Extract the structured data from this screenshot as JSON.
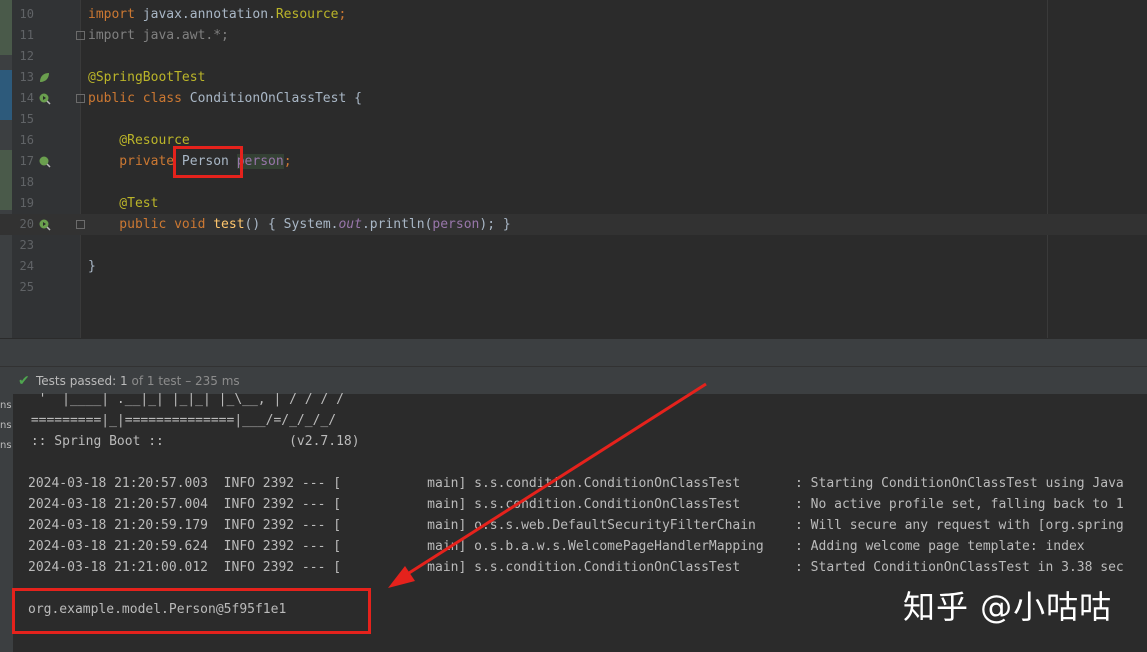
{
  "editor": {
    "lines": [
      {
        "num": "10",
        "segments": [
          {
            "t": "import ",
            "c": "kw"
          },
          {
            "t": "javax.annotation.",
            "c": "cls"
          },
          {
            "t": "Resource",
            "c": "ann"
          },
          {
            "t": ";",
            "c": "kw"
          }
        ]
      },
      {
        "num": "11",
        "segments": [
          {
            "t": "import java.awt.*;",
            "c": "res"
          }
        ]
      },
      {
        "num": "12",
        "segments": []
      },
      {
        "num": "13",
        "segments": [
          {
            "t": "@SpringBootTest",
            "c": "ann"
          }
        ]
      },
      {
        "num": "14",
        "segments": [
          {
            "t": "public class ",
            "c": "kw"
          },
          {
            "t": "ConditionOnClassTest {",
            "c": "cls"
          }
        ]
      },
      {
        "num": "15",
        "segments": []
      },
      {
        "num": "16",
        "segments": [
          {
            "t": "    @Resource",
            "c": "ann"
          }
        ]
      },
      {
        "num": "17",
        "segments": [
          {
            "t": "    private ",
            "c": "kw"
          },
          {
            "t": "Person ",
            "c": "cls"
          },
          {
            "t": "person",
            "c": "fld hl-field"
          },
          {
            "t": ";",
            "c": "kw"
          }
        ]
      },
      {
        "num": "18",
        "segments": []
      },
      {
        "num": "19",
        "segments": [
          {
            "t": "    @Test",
            "c": "ann"
          }
        ]
      },
      {
        "num": "20",
        "segments": [
          {
            "t": "    public void ",
            "c": "kw"
          },
          {
            "t": "test",
            "c": "fn"
          },
          {
            "t": "() { System.",
            "c": "cls"
          },
          {
            "t": "out",
            "c": "it"
          },
          {
            "t": ".println(",
            "c": "cls"
          },
          {
            "t": "person",
            "c": "fld"
          },
          {
            "t": "); }",
            "c": "cls"
          }
        ]
      },
      {
        "num": "23",
        "segments": []
      },
      {
        "num": "24",
        "segments": [
          {
            "t": "}",
            "c": "cls"
          }
        ]
      },
      {
        "num": "25",
        "segments": []
      }
    ]
  },
  "status": {
    "label": "Tests passed:",
    "passed": "1",
    "detail": "of 1 test – 235 ms"
  },
  "console": {
    "side_tabs": [
      "ns",
      "ns",
      "ns"
    ],
    "banner": [
      "  '  |____| .__|_| |_|_| |_\\__, | / / / /",
      " =========|_|==============|___/=/_/_/_/",
      " :: Spring Boot ::                (v2.7.18)"
    ],
    "logs": [
      "2024-03-18 21:20:57.003  INFO 2392 --- [           main] s.s.condition.ConditionOnClassTest       : Starting ConditionOnClassTest using Java",
      "2024-03-18 21:20:57.004  INFO 2392 --- [           main] s.s.condition.ConditionOnClassTest       : No active profile set, falling back to 1",
      "2024-03-18 21:20:59.179  INFO 2392 --- [           main] o.s.s.web.DefaultSecurityFilterChain     : Will secure any request with [org.spring",
      "2024-03-18 21:20:59.624  INFO 2392 --- [           main] o.s.b.a.w.s.WelcomePageHandlerMapping    : Adding welcome page template: index",
      "2024-03-18 21:21:00.012  INFO 2392 --- [           main] s.s.condition.ConditionOnClassTest       : Started ConditionOnClassTest in 3.38 sec"
    ],
    "output": "org.example.model.Person@5f95f1e1"
  },
  "watermark": "知乎 @小咕咕",
  "colors": {
    "highlight": "#e5221c",
    "pass": "#4fa64f"
  }
}
